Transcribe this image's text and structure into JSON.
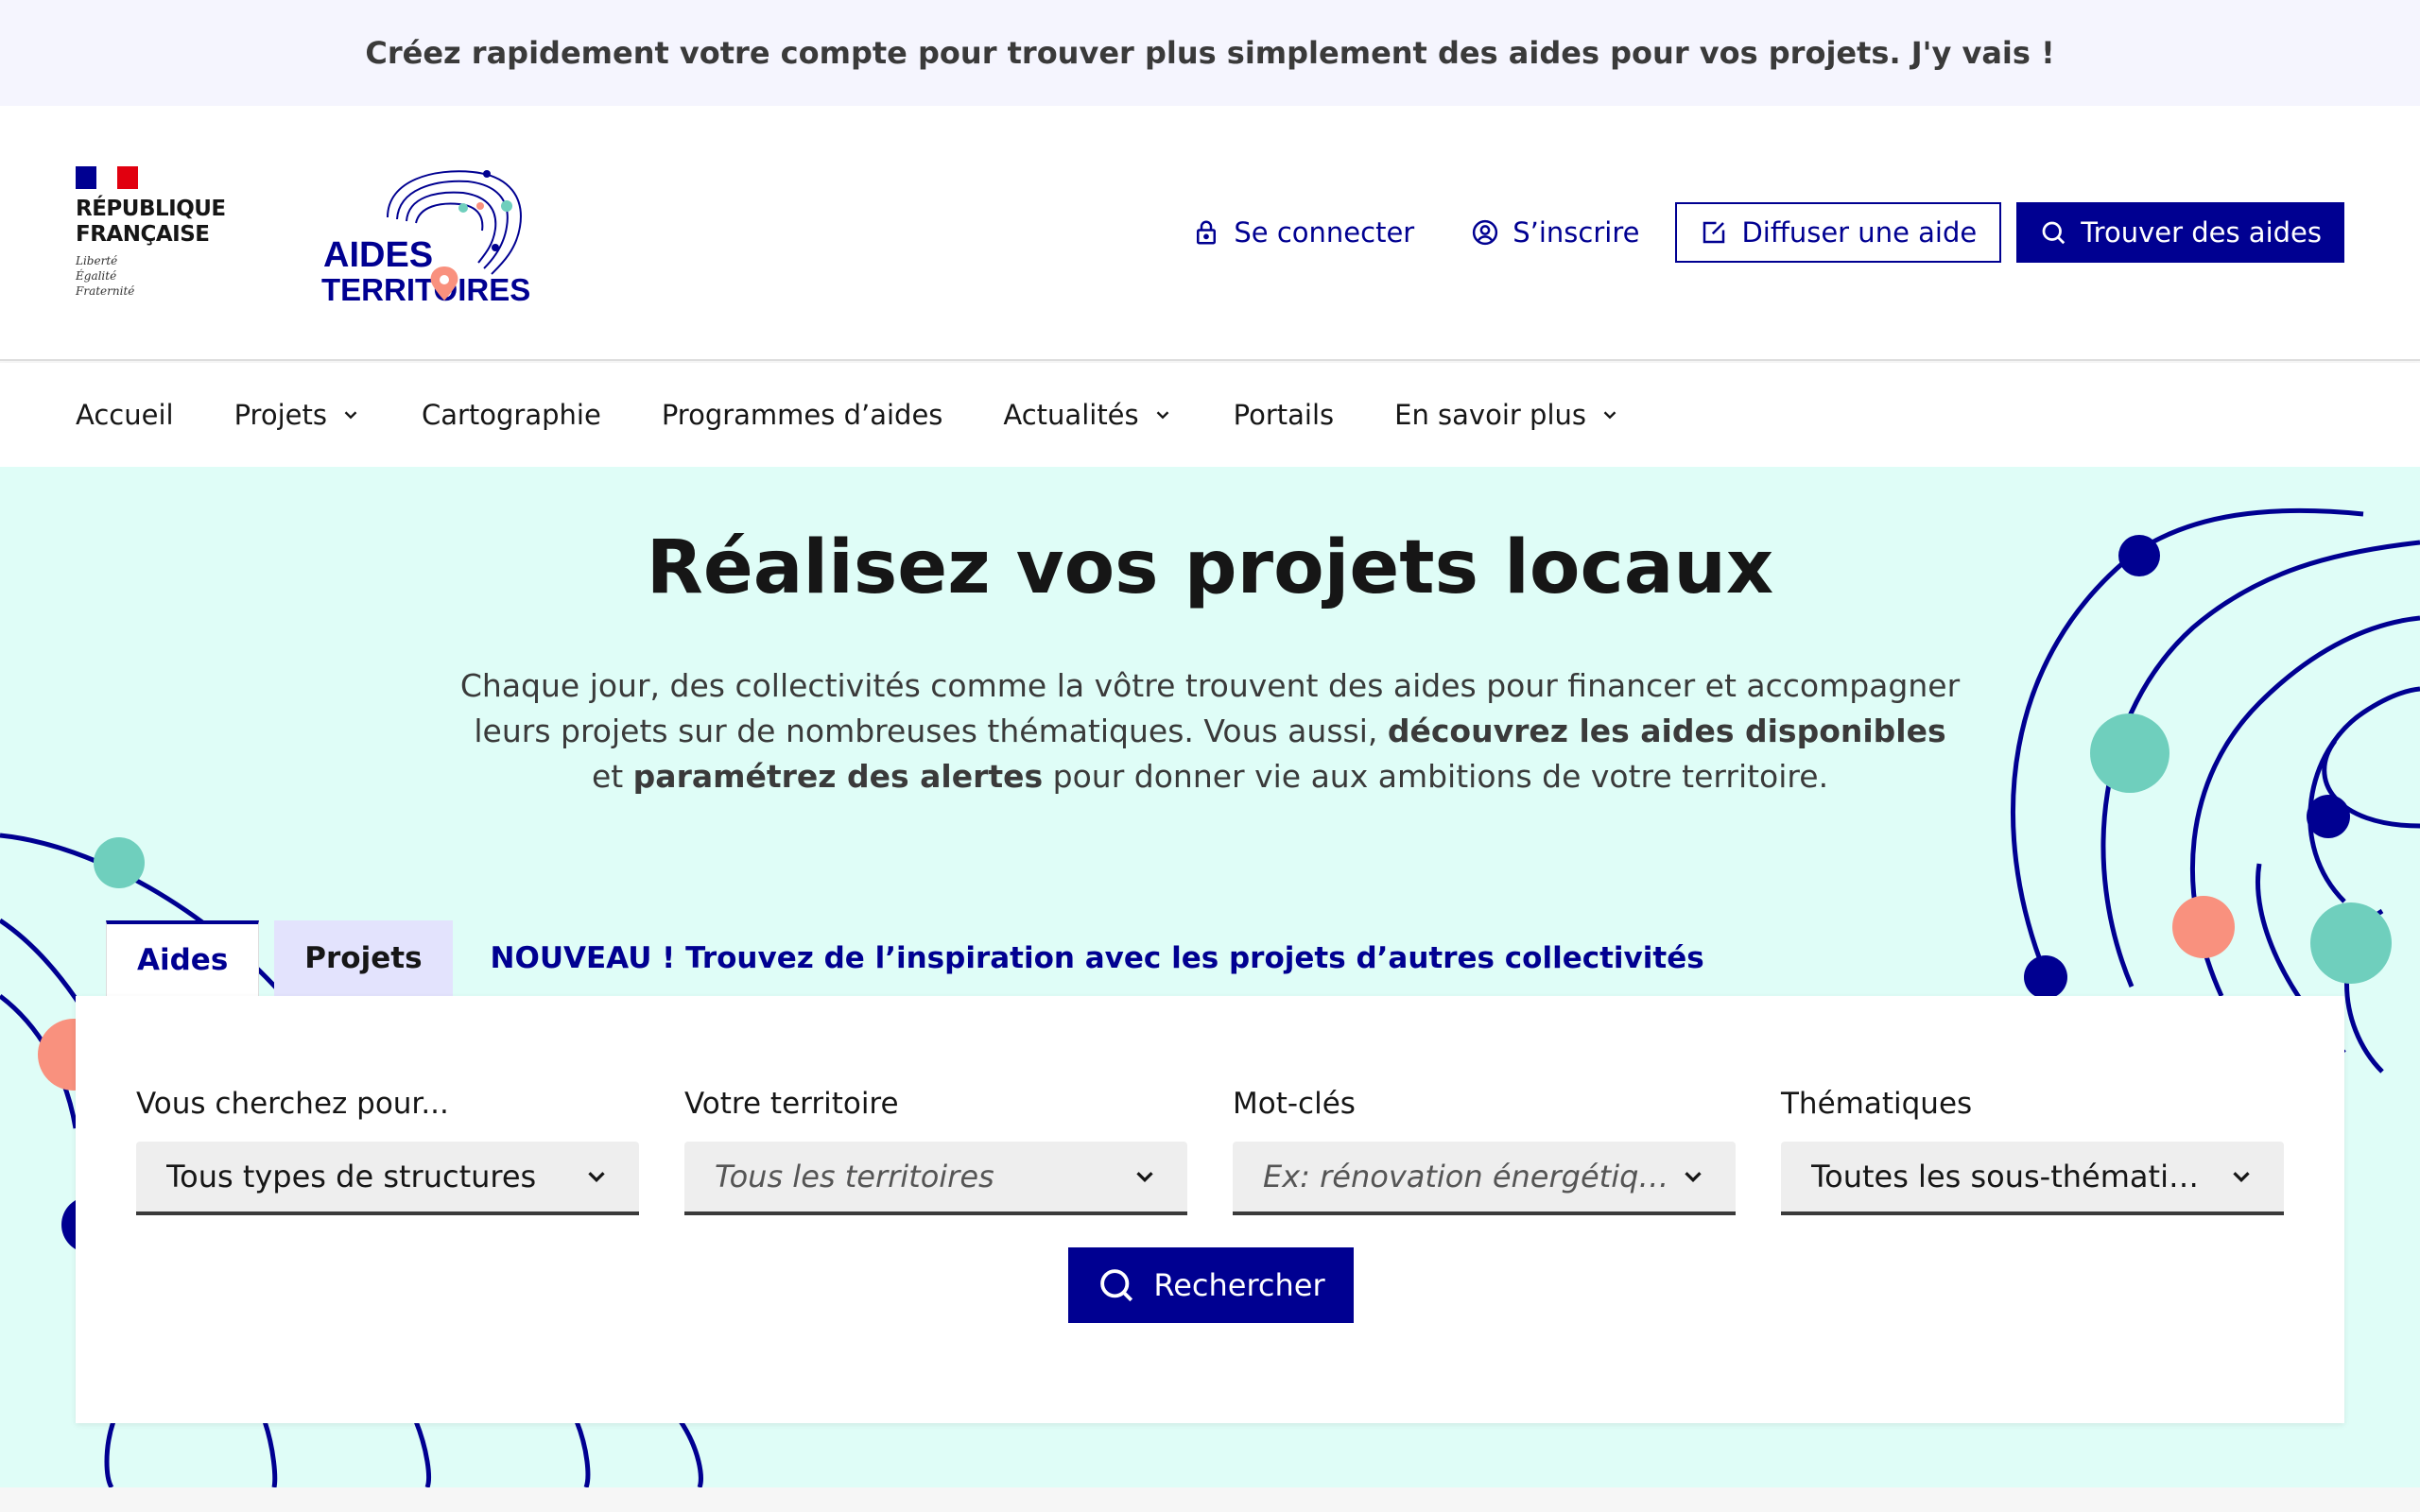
{
  "notice": {
    "text": "Créez rapidement votre compte pour trouver plus simplement des aides pour vos projets. J'y vais !"
  },
  "header": {
    "republique": "RÉPUBLIQUE\nFRANÇAISE",
    "motto": "Liberté\nÉgalité\nFraternité",
    "logo_line1": "AIDES",
    "logo_line2": "TERRITOIRES",
    "login": "Se connecter",
    "signup": "S’inscrire",
    "publish": "Diffuser une aide",
    "find": "Trouver des aides"
  },
  "nav": {
    "items": [
      {
        "label": "Accueil"
      },
      {
        "label": "Projets"
      },
      {
        "label": "Cartographie"
      },
      {
        "label": "Programmes d’aides"
      },
      {
        "label": "Actualités"
      },
      {
        "label": "Portails"
      },
      {
        "label": "En savoir plus"
      }
    ]
  },
  "hero": {
    "title": "Réalisez vos projets locaux",
    "desc_1": "Chaque jour, des collectivités comme la vôtre trouvent des aides pour financer et accompagner leurs projets sur de nombreuses thématiques. Vous aussi, ",
    "desc_bold_1": "découvrez les aides disponibles",
    "desc_2": " et ",
    "desc_bold_2": "paramétrez des alertes",
    "desc_3": " pour donner vie aux ambitions de votre territoire."
  },
  "tabs": {
    "aides": "Aides",
    "projets": "Projets",
    "new": "NOUVEAU ! Trouvez de l’inspiration avec les projets d’autres collectivités"
  },
  "search": {
    "fields": [
      {
        "label": "Vous cherchez pour...",
        "value": "Tous types de structures"
      },
      {
        "label": "Votre territoire",
        "value": "Tous les territoires"
      },
      {
        "label": "Mot-clés",
        "value": "Ex: rénovation énergétique, vélo, tiers lieu..."
      },
      {
        "label": "Thématiques",
        "value": "Toutes les sous-thématiques"
      }
    ],
    "button": "Rechercher"
  },
  "colors": {
    "primary": "#000091",
    "hero_bg": "#dffdf7",
    "teal": "#6fcfbd",
    "coral": "#f9917e"
  }
}
